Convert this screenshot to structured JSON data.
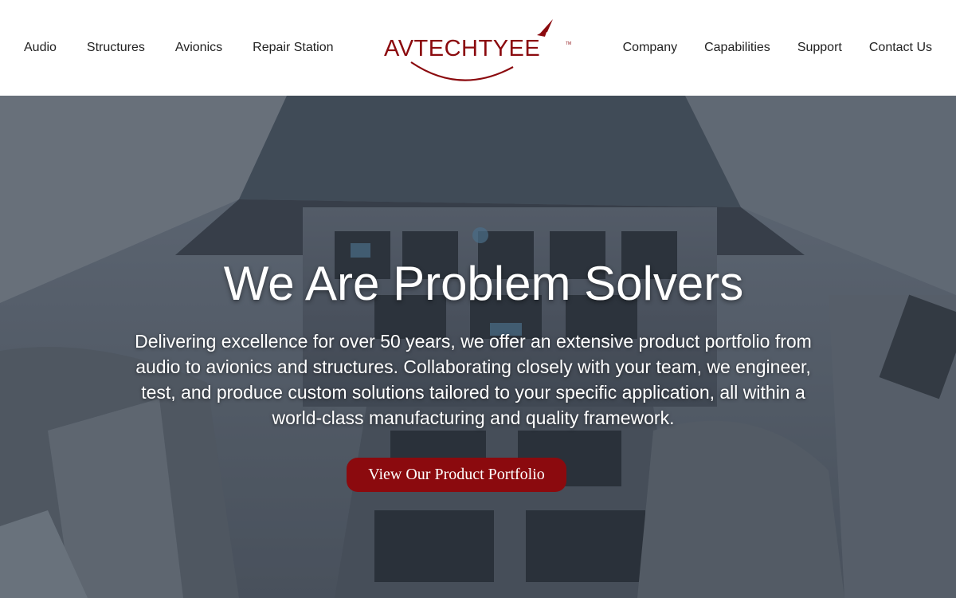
{
  "header": {
    "nav_left": [
      {
        "label": "Audio"
      },
      {
        "label": "Structures"
      },
      {
        "label": "Avionics"
      },
      {
        "label": "Repair Station"
      }
    ],
    "nav_right": [
      {
        "label": "Company"
      },
      {
        "label": "Capabilities"
      },
      {
        "label": "Support"
      },
      {
        "label": "Contact Us"
      }
    ],
    "logo": {
      "text": "AVTECHTYEE",
      "trademark": "TM",
      "icon": "swoosh-logo-icon",
      "brand_color": "#8b0a0e",
      "text_color": "#8b0a0e"
    }
  },
  "hero": {
    "background": "cockpit-photo",
    "title": "We Are Problem Solvers",
    "description": "Delivering excellence for over 50 years, we offer an extensive product portfolio from audio to avionics and structures. Collaborating closely with your team, we engineer, test, and produce custom solutions tailored to your specific application, all within a world-class manufacturing and quality framework.",
    "cta_label": "View Our Product Portfolio",
    "cta_color": "#8b0a0e"
  }
}
